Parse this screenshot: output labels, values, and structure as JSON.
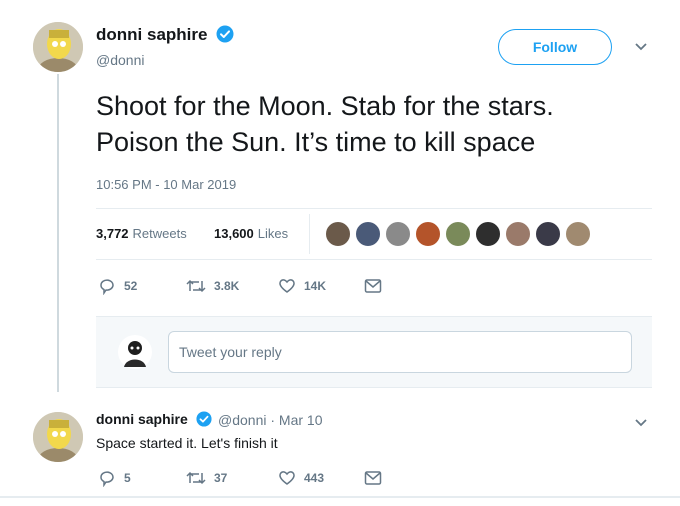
{
  "main_tweet": {
    "author_name": "donni saphire",
    "handle": "@donni",
    "follow_label": "Follow",
    "text_line1": "Shoot for the Moon. Stab for the stars.",
    "text_line2": "Poison the Sun. It’s time to kill space",
    "timestamp": "10:56 PM - 10 Mar 2019",
    "retweets_count": "3,772",
    "retweets_label": "Retweets",
    "likes_count": "13,600",
    "likes_label": "Likes",
    "actions": {
      "replies": "52",
      "retweets": "3.8K",
      "likes": "14K"
    }
  },
  "reply_box": {
    "placeholder": "Tweet your reply"
  },
  "reply_tweet": {
    "author_name": "donni saphire",
    "meta": "@donni · Mar 10",
    "text": "Space started it. Let's finish it",
    "actions": {
      "replies": "5",
      "retweets": "37",
      "likes": "443"
    }
  },
  "colors": {
    "accent": "#1da1f2",
    "text": "#14171a",
    "secondary_text": "#657786",
    "border": "#e6ecf0"
  },
  "icons": [
    "verified-badge-icon",
    "chevron-down-icon",
    "reply-icon",
    "retweet-icon",
    "like-icon",
    "direct-message-icon"
  ]
}
